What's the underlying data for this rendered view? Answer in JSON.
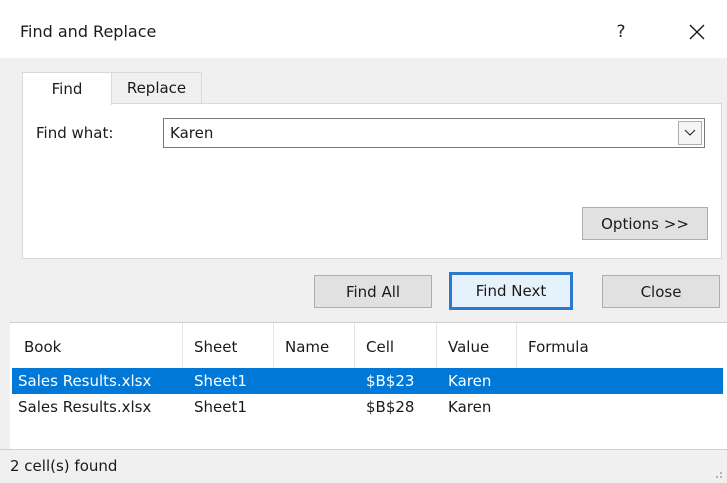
{
  "window": {
    "title": "Find and Replace",
    "help": "?"
  },
  "tabs": [
    {
      "label": "Find",
      "active": true
    },
    {
      "label": "Replace",
      "active": false
    }
  ],
  "find": {
    "label": "Find what:",
    "value": "Karen"
  },
  "buttons": {
    "options": "Options >>",
    "find_all": "Find All",
    "find_next": "Find Next",
    "close": "Close"
  },
  "results": {
    "columns": [
      "Book",
      "Sheet",
      "Name",
      "Cell",
      "Value",
      "Formula"
    ],
    "rows": [
      {
        "book": "Sales Results.xlsx",
        "sheet": "Sheet1",
        "name": "",
        "cell": "$B$23",
        "value": "Karen",
        "formula": "",
        "selected": true
      },
      {
        "book": "Sales Results.xlsx",
        "sheet": "Sheet1",
        "name": "",
        "cell": "$B$28",
        "value": "Karen",
        "formula": "",
        "selected": false
      }
    ]
  },
  "status": "2 cell(s) found",
  "colors": {
    "selection": "#0078d7",
    "focus_border": "#2b79d0"
  }
}
